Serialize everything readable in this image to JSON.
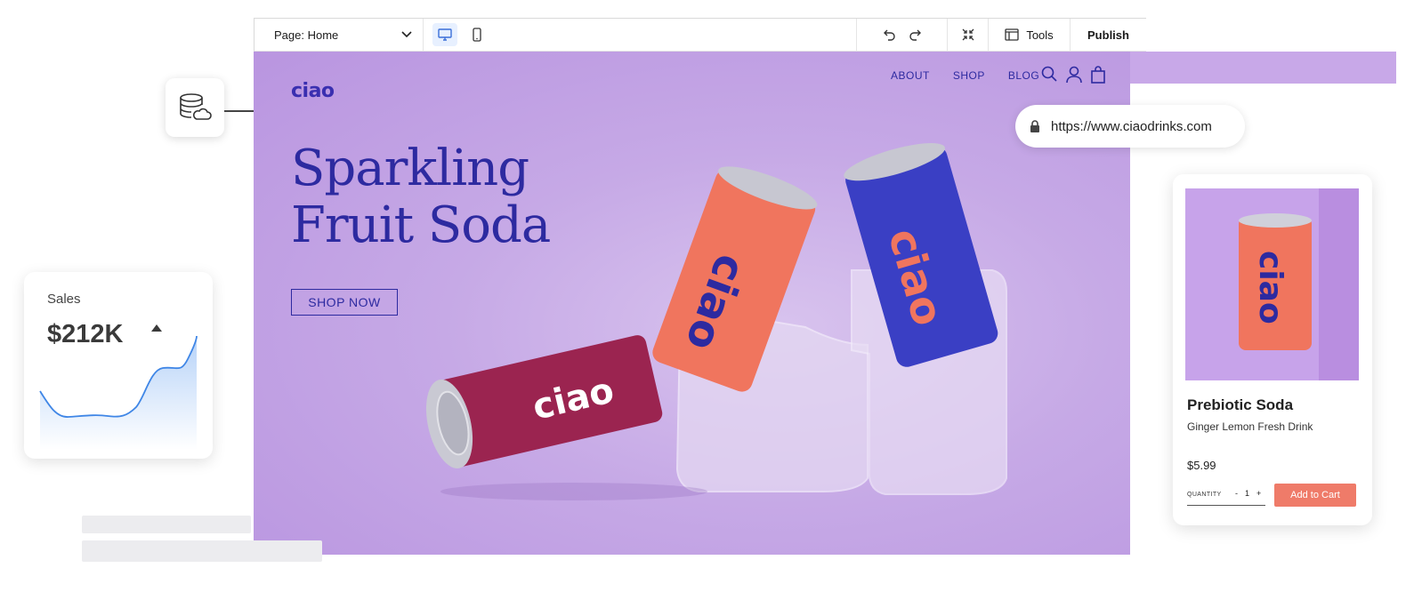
{
  "toolbar": {
    "page_selector": "Page: Home",
    "tools_label": "Tools",
    "publish_label": "Publish"
  },
  "site": {
    "logo": "ciao",
    "nav": [
      "ABOUT",
      "SHOP",
      "BLOG"
    ],
    "hero_title_line1": "Sparkling",
    "hero_title_line2": "Fruit Soda",
    "cta": "SHOP NOW",
    "can_text": "ciao",
    "background_color": "#c6a9e6",
    "brand_color": "#2d2aa0"
  },
  "url_bar": {
    "url": "https://www.ciaodrinks.com"
  },
  "sales": {
    "label": "Sales",
    "value": "$212K",
    "trend": "up"
  },
  "product": {
    "title": "Prebiotic Soda",
    "subtitle": "Ginger Lemon Fresh Drink",
    "price": "$5.99",
    "quantity_label": "QUANTITY",
    "quantity_minus": "-",
    "quantity_value": "1",
    "quantity_plus": "+",
    "add_to_cart": "Add to Cart",
    "accent_color": "#ef7b69"
  }
}
